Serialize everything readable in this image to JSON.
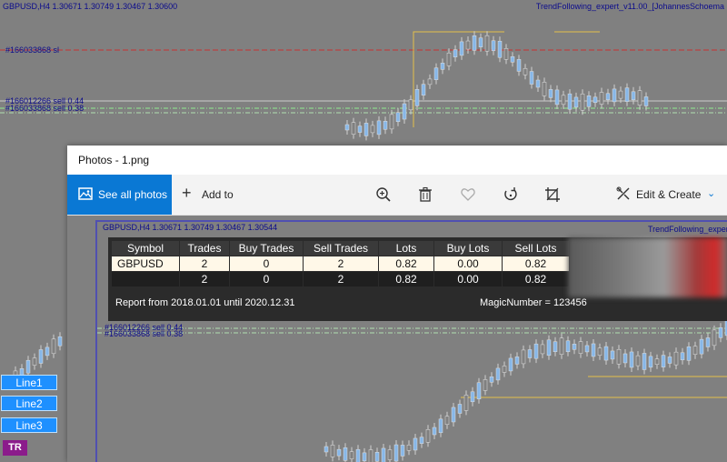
{
  "background_chart": {
    "header": "GBPUSD,H4  1.30671 1.30749 1.30467 1.30600",
    "expert": "TrendFollowing_expert_v11.00_[JohannesSchoema",
    "levels": [
      {
        "label": "#166033868 sl"
      },
      {
        "label": "#166012266 sell 0.44"
      },
      {
        "label": "#166033868 sell 0.38"
      }
    ],
    "buttons": [
      "Line1",
      "Line2",
      "Line3"
    ],
    "badge": "TR"
  },
  "photos_window": {
    "title": "Photos - 1.png",
    "toolbar": {
      "see_all": "See all photos",
      "add_to": "Add to",
      "edit_create": "Edit & Create",
      "icons": [
        "zoom-icon",
        "delete-icon",
        "favorite-icon",
        "rotate-icon",
        "crop-icon"
      ]
    },
    "inner_chart": {
      "header": "GBPUSD,H4  1.30671 1.30749 1.30467 1.30544",
      "expert": "TrendFollowing_expert",
      "levels": [
        "#166012266 sell 0.44",
        "#166033868 sell 0.38"
      ]
    },
    "report": {
      "columns": [
        "Symbol",
        "Trades",
        "Buy Trades",
        "Sell Trades",
        "Lots",
        "Buy Lots",
        "Sell Lots"
      ],
      "rows": [
        [
          "GBPUSD",
          "2",
          "0",
          "2",
          "0.82",
          "0.00",
          "0.82"
        ],
        [
          "",
          "2",
          "0",
          "2",
          "0.82",
          "0.00",
          "0.82"
        ]
      ],
      "from_text": "Report from 2018.01.01 until 2020.12.31",
      "magic_text": "MagicNumber = 123456"
    }
  },
  "colors": {
    "accent": "#0a78d4",
    "chart_bg": "#808080",
    "candle_up": "#87b7e8",
    "sl_line": "#c83232",
    "yellow_line": "#e5c04a"
  }
}
